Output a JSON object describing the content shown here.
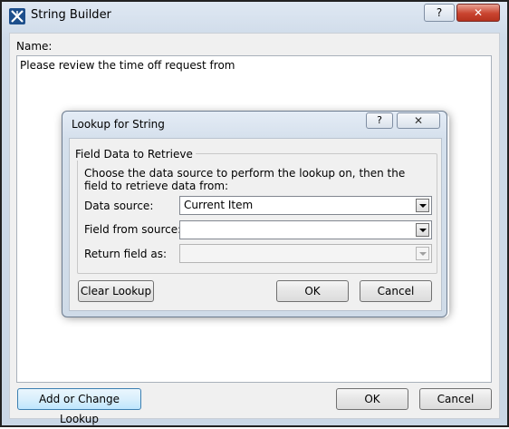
{
  "window": {
    "title": "String Builder",
    "help_label": "?",
    "close_label": "✕"
  },
  "main": {
    "name_label": "Name:",
    "text_value": "Please review the time off request from"
  },
  "footer": {
    "add_change_label": "Add or Change Lookup",
    "ok_label": "OK",
    "cancel_label": "Cancel"
  },
  "lookup_dialog": {
    "title": "Lookup for String",
    "help_label": "?",
    "close_label": "✕",
    "group_title": "Field Data to Retrieve",
    "instructions": "Choose the data source to perform the lookup on, then the field to retrieve data from:",
    "data_source_label": "Data source:",
    "data_source_value": "Current Item",
    "field_from_source_label": "Field from source:",
    "field_from_source_value": "",
    "return_field_label": "Return field as:",
    "return_field_value": "",
    "clear_label": "Clear Lookup",
    "ok_label": "OK",
    "cancel_label": "Cancel"
  },
  "icons": {
    "app": "string-builder-app-icon",
    "dropdown": "chevron-down-icon"
  }
}
